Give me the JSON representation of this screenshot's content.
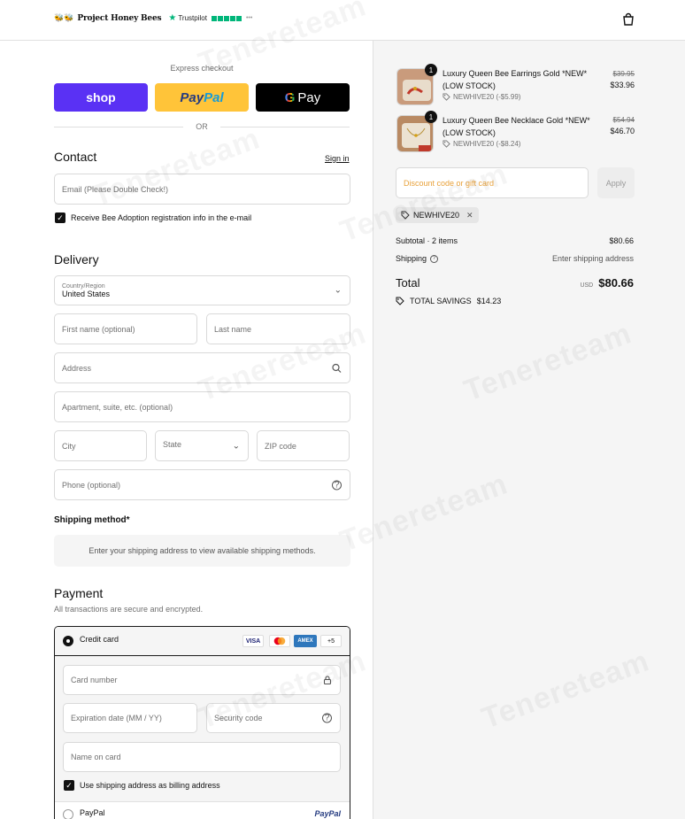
{
  "header": {
    "store_name": "Project Honey Bees",
    "trustpilot_label": "Trustpilot"
  },
  "express": {
    "label": "Express checkout",
    "shop_label": "shop",
    "paypal_label_1": "Pay",
    "paypal_label_2": "Pal",
    "gpay_label_g": "G",
    "gpay_label": "Pay",
    "or_label": "OR"
  },
  "contact": {
    "title": "Contact",
    "sign_in": "Sign in",
    "email_placeholder": "Email (Please Double Check!)",
    "newsletter_label": "Receive Bee Adoption registration info in the e-mail"
  },
  "delivery": {
    "title": "Delivery",
    "country_label": "Country/Region",
    "country_value": "United States",
    "first_name": "First name (optional)",
    "last_name": "Last name",
    "address": "Address",
    "apartment": "Apartment, suite, etc. (optional)",
    "city": "City",
    "state": "State",
    "zip": "ZIP code",
    "phone": "Phone (optional)"
  },
  "shipping": {
    "title": "Shipping method*",
    "message": "Enter your shipping address to view available shipping methods."
  },
  "payment": {
    "title": "Payment",
    "subtitle": "All transactions are secure and encrypted.",
    "credit_card": "Credit card",
    "visa": "VISA",
    "amex": "AMEX",
    "more": "+5",
    "card_number": "Card number",
    "expiration": "Expiration date (MM / YY)",
    "security": "Security code",
    "name_on_card": "Name on card",
    "billing_same": "Use shipping address as billing address",
    "paypal": "PayPal",
    "paypal_logo": "PayPal"
  },
  "summary": {
    "items": [
      {
        "quantity": "1",
        "title": "Luxury Queen Bee Earrings Gold *NEW* (LOW STOCK)",
        "discount": "NEWHIVE20 (-$5.99)",
        "original_price": "$39.95",
        "price": "$33.96"
      },
      {
        "quantity": "1",
        "title": "Luxury Queen Bee Necklace Gold *NEW* (LOW STOCK)",
        "discount": "NEWHIVE20 (-$8.24)",
        "original_price": "$54.94",
        "price": "$46.70"
      }
    ],
    "discount_placeholder": "Discount code or gift card",
    "apply_label": "Apply",
    "applied_code": "NEWHIVE20",
    "subtotal_label": "Subtotal · 2 items",
    "subtotal_value": "$80.66",
    "shipping_label": "Shipping",
    "shipping_value": "Enter shipping address",
    "total_label": "Total",
    "currency": "USD",
    "total_value": "$80.66",
    "savings_label": "TOTAL SAVINGS",
    "savings_value": "$14.23"
  },
  "watermark": "Tenereteam",
  "colors": {
    "shop": "#5a31f4",
    "paypal": "#ffc439",
    "gpay": "#000000",
    "accent_discount": "#e8a13a",
    "trustpilot": "#00b67a"
  }
}
